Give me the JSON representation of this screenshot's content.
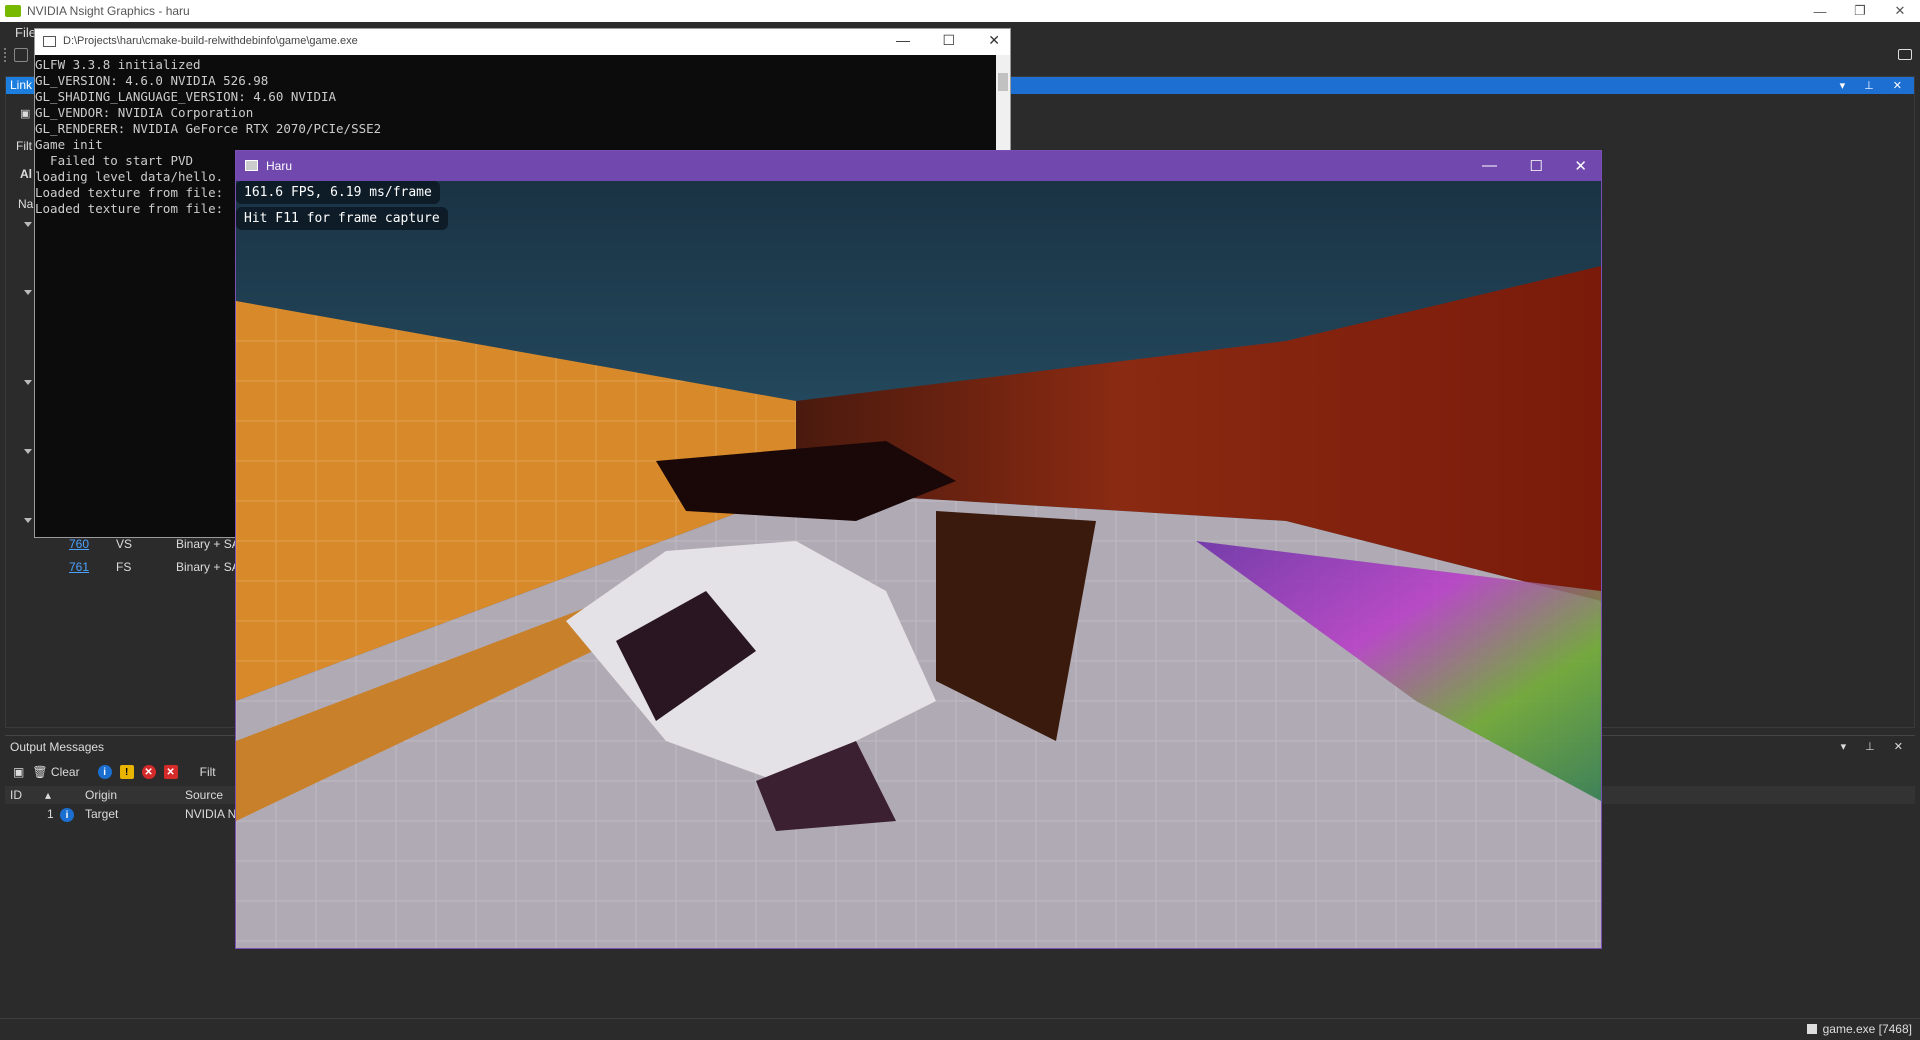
{
  "nsight": {
    "title": "NVIDIA Nsight Graphics - haru",
    "menu_first": "File",
    "linked_tab": "Link",
    "filter_label": "Filt",
    "all_label": "Al",
    "name_label": "Na",
    "rows": [
      {
        "id": "760",
        "stage": "VS",
        "type": "Binary + SA"
      },
      {
        "id": "761",
        "stage": "FS",
        "type": "Binary + SA"
      }
    ]
  },
  "output": {
    "title": "Output Messages",
    "clear_label": "Clear",
    "filter_label": "Filt",
    "columns": {
      "id": "ID",
      "origin": "Origin",
      "source": "Source"
    },
    "message": {
      "id": "1",
      "origin": "Target",
      "source": "NVIDIA N"
    }
  },
  "status": {
    "process": "game.exe [7468]"
  },
  "console": {
    "title": "D:\\Projects\\haru\\cmake-build-relwithdebinfo\\game\\game.exe",
    "lines": "GLFW 3.3.8 initialized\nGL_VERSION: 4.6.0 NVIDIA 526.98\nGL_SHADING_LANGUAGE_VERSION: 4.60 NVIDIA\nGL_VENDOR: NVIDIA Corporation\nGL_RENDERER: NVIDIA GeForce RTX 2070/PCIe/SSE2\nGame init\n  Failed to start PVD\nloading level data/hello.\nLoaded texture from file:\nLoaded texture from file:"
  },
  "game": {
    "title": "Haru",
    "fps": "161.6 FPS, 6.19 ms/frame",
    "hint": "Hit F11 for frame capture"
  },
  "colors": {
    "accent": "#1c7fe0",
    "game_titlebar": "#7048ae",
    "orange_wall": "#d8892a",
    "floor": "#b0aab4"
  }
}
